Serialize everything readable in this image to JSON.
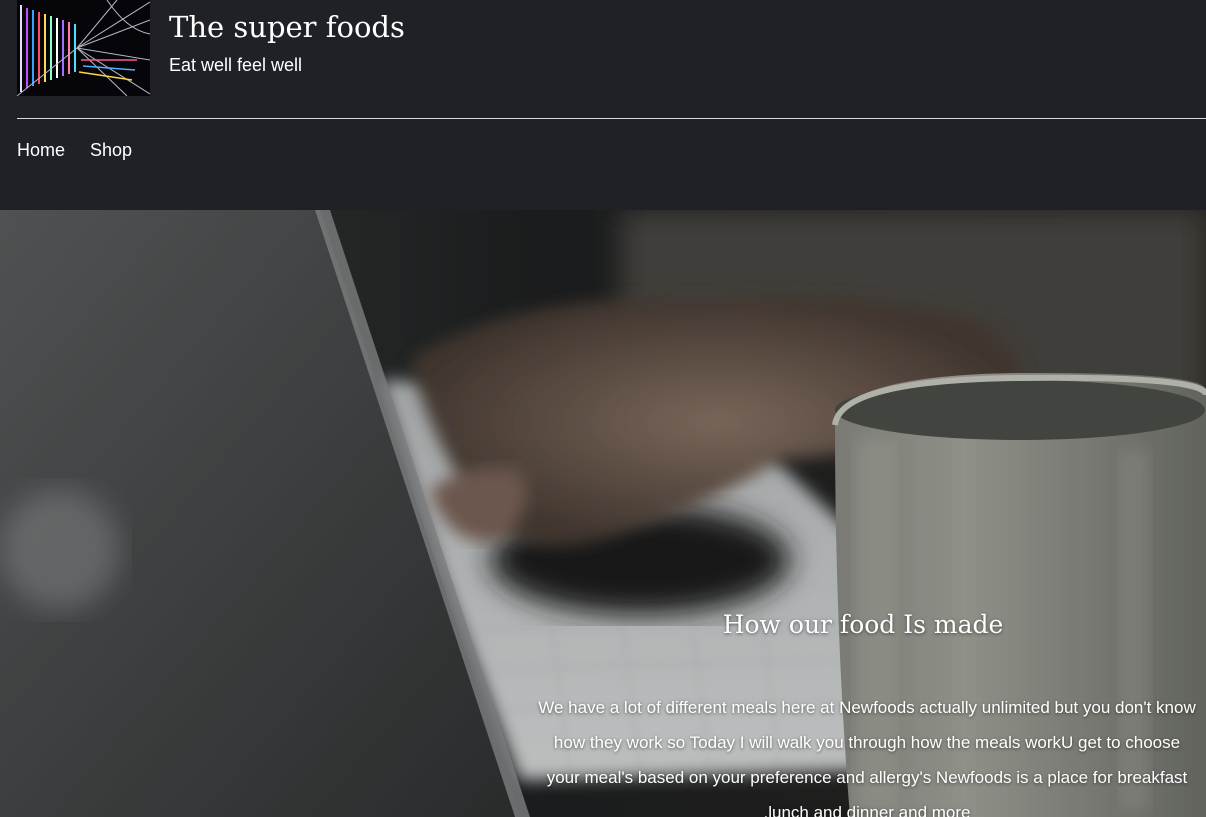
{
  "header": {
    "logo_icon": "abstract-neon-lines-image",
    "title": "The super foods",
    "tagline": "Eat well feel well"
  },
  "nav": {
    "items": [
      {
        "label": "Home"
      },
      {
        "label": "Shop"
      }
    ]
  },
  "hero": {
    "background_image": "laptop-and-coffee-mug-photo",
    "title": "How our food Is made",
    "body": "We have a lot of different meals here at Newfoods actually unlimited but you don't know how they work so Today I will walk you through how the meals workU get to choose your meal's based on your preference and allergy's Newfoods is a place for breakfast ,lunch and dinner and more"
  },
  "colors": {
    "header_bg": "#202126",
    "text": "#ffffff",
    "divider": "#d8d8d8"
  }
}
